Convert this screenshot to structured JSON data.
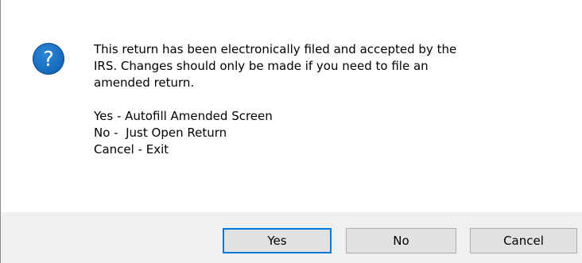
{
  "message": {
    "lines": [
      "This return has been electronically filed and accepted by the",
      "IRS. Changes should only be made if you need to file an",
      "amended return."
    ],
    "options": [
      "Yes - Autofill Amended Screen",
      "No -  Just Open Return",
      "Cancel - Exit"
    ]
  },
  "buttons": {
    "yes": "Yes",
    "no": "No",
    "cancel": "Cancel"
  },
  "icon": {
    "name": "question-icon",
    "glyph": "?",
    "color": "#1a6fc1"
  },
  "colors": {
    "footer_bg": "#f0f0f0",
    "button_bg": "#e1e1e1",
    "default_button_border": "#0078d7"
  }
}
